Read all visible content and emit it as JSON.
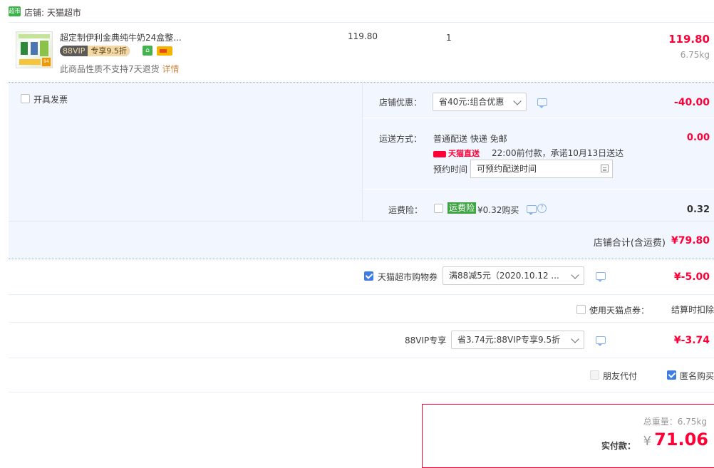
{
  "store": {
    "icon_text": "超市",
    "label": "店铺: 天猫超市"
  },
  "product": {
    "thumb_tag": "94",
    "name": "超定制伊利金典纯牛奶24盒整...",
    "vip_left": "88VIP",
    "vip_right": "专享9.5折",
    "note": "此商品性质不支持7天退货",
    "note_link": "详情",
    "price": "119.80",
    "qty": "1",
    "subtotal": "119.80",
    "weight": "6.75kg"
  },
  "invoice": {
    "label": "开具发票"
  },
  "store_discount": {
    "label": "店铺优惠：",
    "selected": "省40元:组合优惠",
    "amount": "-40.00"
  },
  "shipping": {
    "label": "运送方式：",
    "method": "普通配送 快递 免邮",
    "badge": "天猫直送",
    "promise": "22:00前付款，承诺10月13日送达",
    "appoint_label": "预约时间",
    "appoint_placeholder": "可预约配送时间",
    "amount": "0.00"
  },
  "insurance": {
    "label": "运费险：",
    "tag": "运费险",
    "price": "¥0.32购买",
    "amount": "0.32"
  },
  "store_total": {
    "label": "店铺合计(含运费)",
    "amount": "¥79.80"
  },
  "coupon": {
    "label": "天猫超市购物券",
    "selected": "满88减5元（2020.10.12 ...",
    "amount": "¥-5.00",
    "checked": true
  },
  "points": {
    "label": "使用天猫点券：",
    "note": "结算时扣除"
  },
  "vip": {
    "label": "88VIP专享",
    "selected": "省3.74元:88VIP专享9.5折",
    "amount": "¥-3.74"
  },
  "options": {
    "friend_pay": "朋友代付",
    "anonymous": "匿名购买"
  },
  "summary": {
    "weight_text": "总重量：6.75kg",
    "pay_label": "实付款：",
    "currency": "¥",
    "pay_amount": "71.06"
  },
  "colors": {
    "accent": "#ff0036",
    "panel": "#f2f7ff",
    "checkbox": "#3d7de5"
  }
}
